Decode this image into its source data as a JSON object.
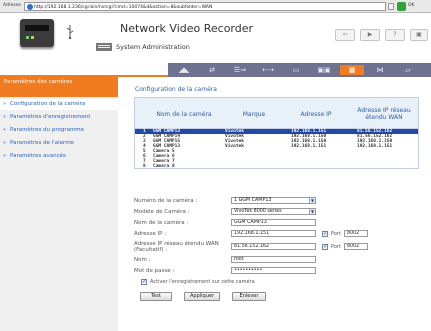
{
  "browser": {
    "address_label": "Adresse",
    "url": "http://192.168.1.236/cgi-bin/nvrcgi?cmd=10074&4&action=8&subfolder=WAN",
    "go_label": "OK"
  },
  "header": {
    "title": "Network Video Recorder",
    "subtitle": "System Administration",
    "buttons": [
      "⇦",
      "▶",
      "?",
      "▣"
    ]
  },
  "toolbar": {
    "icons": [
      "◢◣",
      "⇄",
      "☰⇒",
      "⇠⇢",
      "▭",
      "▣▣",
      "▦",
      "⋈",
      "▱"
    ]
  },
  "sidebar": {
    "header": "Paramètres des caméras",
    "items": [
      {
        "label": "Configuration de la caméra",
        "active": true
      },
      {
        "label": "Paramètres d'enregistrement",
        "active": false
      },
      {
        "label": "Paramètres du programme",
        "active": false
      },
      {
        "label": "Paramètres de l'alarme",
        "active": false
      },
      {
        "label": "Paramètres avancés",
        "active": false
      }
    ]
  },
  "main": {
    "title": "Configuration de la caméra",
    "table": {
      "headers": [
        "Nom de la caméra",
        "Marque",
        "Adresse IP",
        "Adresse IP réseau étendu WAN"
      ],
      "rows": [
        {
          "num": "1",
          "name": "GGM CAMP13",
          "brand": "Vivotek",
          "ip": "192.168.1.151",
          "wan": "81.56.152.162",
          "selected": true
        },
        {
          "num": "2",
          "name": "GGM CAMP14",
          "brand": "Vivotek",
          "ip": "192.168.1.150",
          "wan": "81.56.152.162",
          "selected": false
        },
        {
          "num": "3",
          "name": "GGM CAMP15",
          "brand": "Vivotek",
          "ip": "192.168.1.150",
          "wan": "192.168.1.150",
          "selected": false
        },
        {
          "num": "4",
          "name": "GGM CAMP13",
          "brand": "Vivotek",
          "ip": "192.168.1.151",
          "wan": "192.168.1.151",
          "selected": false
        },
        {
          "num": "5",
          "name": "Camera 5",
          "brand": "",
          "ip": "",
          "wan": "",
          "selected": false
        },
        {
          "num": "6",
          "name": "Camera 6",
          "brand": "",
          "ip": "",
          "wan": "",
          "selected": false
        },
        {
          "num": "7",
          "name": "Camera 7",
          "brand": "",
          "ip": "",
          "wan": "",
          "selected": false
        },
        {
          "num": "8",
          "name": "Camera 8",
          "brand": "",
          "ip": "",
          "wan": "",
          "selected": false
        }
      ]
    },
    "form": {
      "camera_number_label": "Numéro de la caméra :",
      "camera_number_value": "1 GGM CAMP13",
      "model_label": "Modèle de Caméra :",
      "model_value": "VivoTek 8000 series",
      "name_label": "Nom de la caméra :",
      "name_value": "GGM CAMP13",
      "ip_label": "Adresse IP :",
      "ip_value": "192.168.1.151",
      "port_label": "Port",
      "port_value": "8002",
      "wan_label": "Adresse IP réseau étendu WAN (Facultatif) :",
      "wan_value": "81.56.152.162",
      "wan_port_value": "8002",
      "user_label": "Nom :",
      "user_value": "root",
      "password_label": "Mot de passe :",
      "password_value": "••••••••••",
      "enable_label": "Activer l'enregistrement sur cette caméra",
      "test_button": "Test",
      "apply_button": "Appliquer",
      "remove_button": "Enlever"
    }
  }
}
